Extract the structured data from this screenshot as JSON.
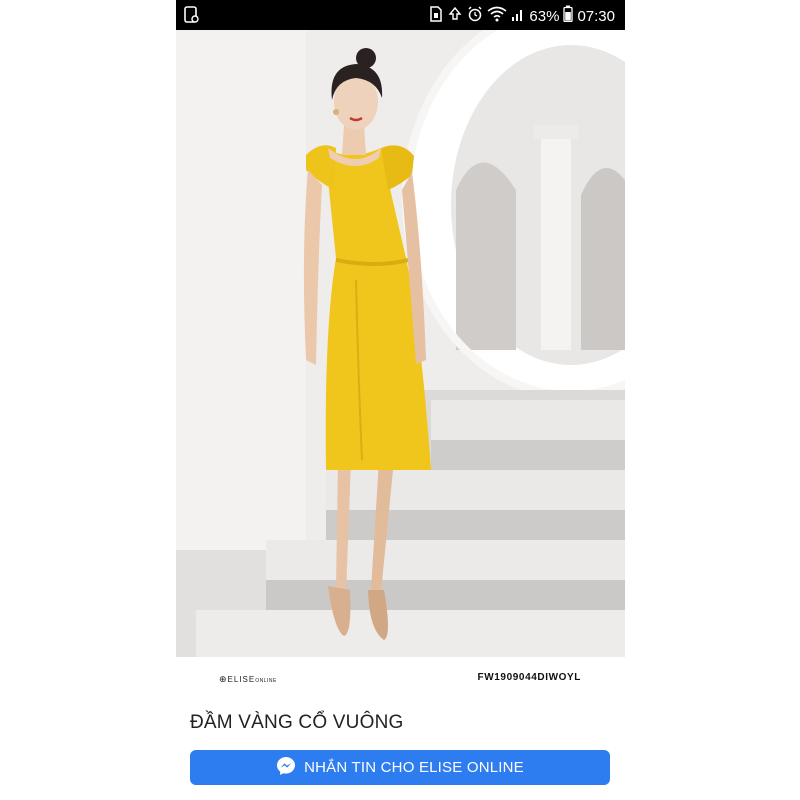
{
  "status_bar": {
    "battery_percent": "63%",
    "time": "07:30",
    "icons": [
      "screenshot-icon",
      "alarm-clock-icon",
      "wifi-icon",
      "signal-icon",
      "battery-icon"
    ]
  },
  "product": {
    "brand": "ELISE",
    "brand_suffix": "ONLINE",
    "sku": "FW1909044DIWOYL",
    "title": "ĐẦM VÀNG CỔ VUÔNG"
  },
  "cta": {
    "label": "NHẮN TIN CHO ELISE ONLINE",
    "icon": "messenger-icon",
    "color": "#2d7cf0"
  },
  "colors": {
    "dress": "#f0c61c",
    "status_bar": "#000000"
  }
}
